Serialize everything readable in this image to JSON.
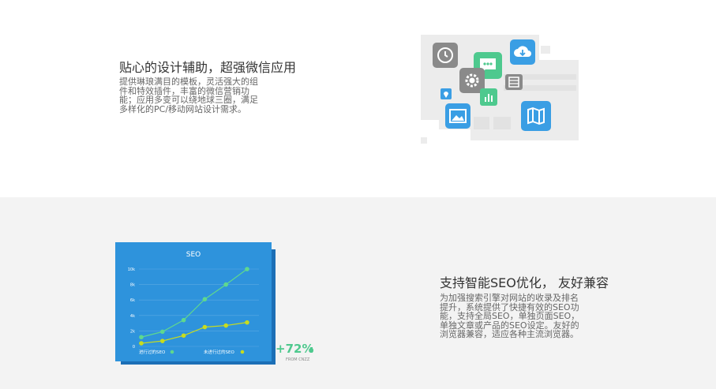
{
  "feature1": {
    "title": "贴心的设计辅助，超强微信应用",
    "description": "提供琳琅满目的模板，灵活强大的组件和特效插件，丰富的微信营销功能；应用多变可以绕地球三圈，满足多样化的PC/移动网站设计需求。"
  },
  "feature2": {
    "title": "支持智能SEO优化， 友好兼容",
    "description": "为加强搜索引擎对网站的收录及排名提升，系统提供了快捷有效的SEO功能，支持全局SEO，单独页面SEO，单独文章或产品的SEO设定。友好的浏览器兼容，适应各种主流浏览器。"
  },
  "illustration": {
    "icons": [
      "clock-icon",
      "chat-icon",
      "cloud-download-icon",
      "gear-icon",
      "film-icon",
      "location-pin-icon",
      "bar-chart-icon",
      "image-icon",
      "map-icon"
    ],
    "colors": {
      "clock": "#888888",
      "chat": "#4ec98e",
      "cloud": "#3a9ee4",
      "gear": "#888888",
      "film": "#888888",
      "pin": "#3a9ee4",
      "bars": "#4ec98e",
      "image": "#3a9ee4",
      "map": "#3a9ee4"
    }
  },
  "seo_badge": {
    "percent": "+72%",
    "source": "FROM CNZZ"
  },
  "chart_data": {
    "type": "line",
    "title": "SEO",
    "x": [
      1,
      2,
      3,
      4,
      5,
      6
    ],
    "ylim": [
      0,
      10
    ],
    "yticks": [
      "0",
      "2k",
      "4k",
      "6k",
      "8k",
      "10k"
    ],
    "grid": true,
    "legend": "bottom",
    "series": [
      {
        "name": "进行过的SEO",
        "color": "#5fd88e",
        "values": [
          1.2,
          1.9,
          3.4,
          6.1,
          8.0,
          10.0
        ]
      },
      {
        "name": "未进行过的SEO",
        "color": "#c8dc1e",
        "values": [
          0.4,
          0.7,
          1.4,
          2.5,
          2.7,
          3.1
        ]
      }
    ]
  }
}
